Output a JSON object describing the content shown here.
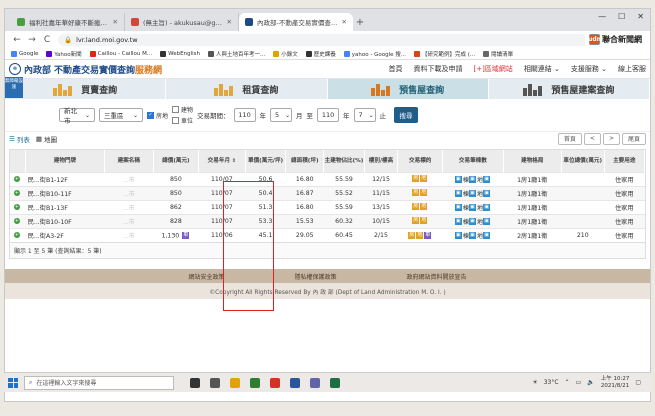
{
  "browser": {
    "tabs": [
      {
        "title": "福利社嘉年華好康不斷瘋狂領...",
        "color": "#4a9d41"
      },
      {
        "title": "(無主旨) - akukusau@gmail.co",
        "color": "#d44638"
      },
      {
        "title": "內政部-不動產交易實價查詢服務",
        "color": "#1e4a86"
      }
    ],
    "new_tab": "+",
    "window_controls": [
      "—",
      "☐",
      "✕"
    ],
    "nav": {
      "back": "←",
      "forward": "→",
      "reload": "C"
    },
    "url": "lvr.land.moi.gov.tw",
    "udn_badge": "聯合新聞網",
    "udn_mark": "udn",
    "bookmarks": [
      {
        "label": "Google",
        "color": "#4285f4"
      },
      {
        "label": "Yahoo新聞",
        "color": "#6001d2"
      },
      {
        "label": "Caillou - Caillou M...",
        "color": "#e62117"
      },
      {
        "label": "WebEnglish",
        "color": "#333333"
      },
      {
        "label": "人與土地百年考一...",
        "color": "#555555"
      },
      {
        "label": "小錄文",
        "color": "#e0a300"
      },
      {
        "label": "歷史課養",
        "color": "#333333"
      },
      {
        "label": "yahoo - Google 搜...",
        "color": "#4285f4"
      },
      {
        "label": "【研究範例】完成 (...",
        "color": "#d84315"
      },
      {
        "label": "閱讀清單",
        "color": "#666666"
      }
    ]
  },
  "site": {
    "logo_emblem": "內政部",
    "brand_main": "不動產交易實價查詢",
    "brand_accent": "服務網",
    "nav": [
      "首頁",
      "資料下載及申請",
      "[+]區域網站",
      "相關連結 ⌄",
      "支援服務 ⌄",
      "線上客服"
    ],
    "accessibility": "無障礙設施",
    "categories": [
      "買賣查詢",
      "租賃查詢",
      "預售屋查詢",
      "預售屋建案查詢"
    ]
  },
  "search": {
    "city": "新北市",
    "district": "三重區",
    "checkboxes": [
      {
        "label": "房地",
        "checked": true
      },
      {
        "label": "建物",
        "checked": false
      },
      {
        "label": "車位",
        "checked": false
      }
    ],
    "period_label": "交易期間：",
    "from_year": "110",
    "year_unit": "年",
    "from_month": "5",
    "month_unit": "月",
    "to_label": "至",
    "to_year": "110",
    "to_month": "7",
    "until": "止",
    "button": "搜尋"
  },
  "list": {
    "view_list": "列表",
    "view_map": "地圖",
    "pager": [
      "首頁",
      "<",
      ">",
      "尾頁"
    ],
    "columns": [
      "",
      "建物門牌",
      "建案名稱",
      "總價(萬元)",
      "交易年月",
      "單價(萬元/坪)",
      "總面積(坪)",
      "主建物佔比(%)",
      "樓別/樓高",
      "交易標的",
      "交易筆棟數",
      "建物格局",
      "車位總價(萬元)",
      "主要用途"
    ],
    "rows": [
      {
        "addr": "民...街B1-12F",
        "project": "...市",
        "price": "850",
        "date": "110/07",
        "unit": "50.6",
        "area": "16.80",
        "ratio": "55.59",
        "floor": "12/15",
        "targets": [
          "房",
          "地"
        ],
        "count": "1 棟 1 地 0",
        "layout": "1房1廳1衛",
        "parking": "",
        "use": "住家用"
      },
      {
        "addr": "民...街B10-11F",
        "project": "...市",
        "price": "850",
        "date": "110/07",
        "unit": "50.4",
        "area": "16.87",
        "ratio": "55.52",
        "floor": "11/15",
        "targets": [
          "房",
          "地"
        ],
        "count": "1 棟 1 地 0",
        "layout": "1房1廳1衛",
        "parking": "",
        "use": "住家用"
      },
      {
        "addr": "民...街B1-13F",
        "project": "...市",
        "price": "862",
        "date": "110/07",
        "unit": "51.3",
        "area": "16.80",
        "ratio": "55.59",
        "floor": "13/15",
        "targets": [
          "房",
          "地"
        ],
        "count": "1 棟 1 地 0",
        "layout": "1房1廳1衛",
        "parking": "",
        "use": "住家用"
      },
      {
        "addr": "民...街B10-10F",
        "project": "...市",
        "price": "828",
        "date": "110/07",
        "unit": "53.3",
        "area": "15.53",
        "ratio": "60.32",
        "floor": "10/15",
        "targets": [
          "房",
          "地"
        ],
        "count": "1 棟 1 地 0",
        "layout": "1房1廳1衛",
        "parking": "",
        "use": "住家用"
      },
      {
        "addr": "民...街A3-2F",
        "project": "...市",
        "price": "1,130",
        "date": "110/06",
        "unit": "45.1",
        "area": "29.05",
        "ratio": "60.45",
        "floor": "2/15",
        "targets": [
          "房",
          "地",
          "車"
        ],
        "count": "1 棟 1 地 1",
        "layout": "2房1廳1衛",
        "parking": "210",
        "use": "住家用"
      }
    ],
    "summary": "顯示 1 至 5 筆 (查詢結果：5 筆)"
  },
  "footer": {
    "links": [
      "網站安全政策",
      "隱私權保護政策",
      "政府網站資料開放宣告"
    ],
    "copyright": "©Copyright All Rights Reserved By 內 政 部 (Dept of Land Administration M. O. I. )"
  },
  "taskbar": {
    "search_placeholder": "在這裡輸入文字來搜尋",
    "app_colors": [
      "#333333",
      "#555555",
      "#e0a300",
      "#2f7d32",
      "#d93025",
      "#2b579a",
      "#6264a7",
      "#1d6f42"
    ],
    "weather": "33°C",
    "time": "上午 10:27",
    "date": "2021/8/21"
  }
}
